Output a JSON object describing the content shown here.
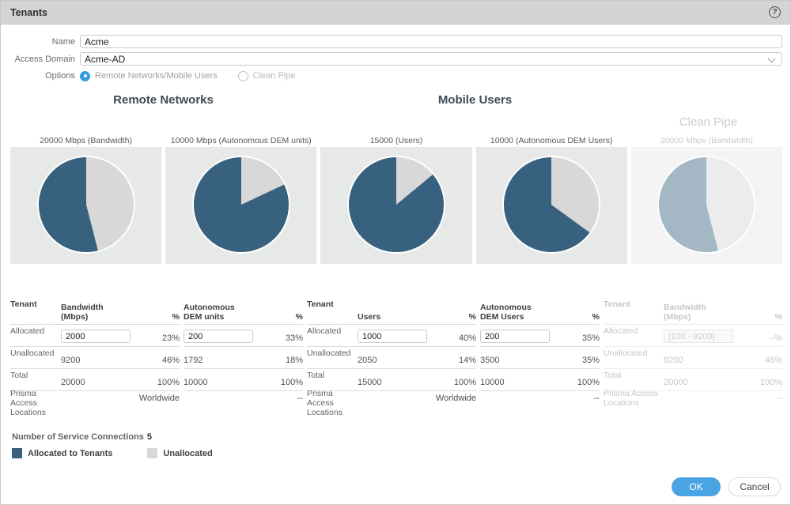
{
  "titlebar": {
    "title": "Tenants",
    "help_icon": "?"
  },
  "form": {
    "name_label": "Name",
    "name_value": "Acme",
    "access_domain_label": "Access Domain",
    "access_domain_value": "Acme-AD",
    "options_label": "Options",
    "option_rn_mu": "Remote Networks/Mobile Users",
    "option_clean_pipe": "Clean Pipe"
  },
  "sections": {
    "remote_networks": "Remote Networks",
    "mobile_users": "Mobile Users",
    "clean_pipe": "Clean Pipe"
  },
  "charts": [
    {
      "label": "20000 Mbps (Bandwidth)",
      "type": "pie",
      "allocated_pct": 54,
      "unallocated_pct": 46,
      "fill": "#38617f",
      "slice": "#d8d8d8",
      "disabled": false
    },
    {
      "label": "10000 Mbps (Autonomous DEM units)",
      "type": "pie",
      "allocated_pct": 82,
      "unallocated_pct": 18,
      "fill": "#38617f",
      "slice": "#d8d8d8",
      "disabled": false
    },
    {
      "label": "15000 (Users)",
      "type": "pie",
      "allocated_pct": 86,
      "unallocated_pct": 14,
      "fill": "#38617f",
      "slice": "#d8d8d8",
      "disabled": false
    },
    {
      "label": "10000 (Autonomous DEM Users)",
      "type": "pie",
      "allocated_pct": 65,
      "unallocated_pct": 35,
      "fill": "#38617f",
      "slice": "#d8d8d8",
      "disabled": false
    },
    {
      "label": "20000 Mbps (Bandwidth)",
      "type": "pie",
      "allocated_pct": 54,
      "unallocated_pct": 46,
      "fill": "#a4b7c5",
      "slice": "#ececec",
      "disabled": true
    }
  ],
  "tables": [
    {
      "corner": "Tenant",
      "value_header": "Bandwidth (Mbps)",
      "pct_header": "%",
      "rows": [
        {
          "label": "Allocated",
          "value": "2000",
          "pct": "23%"
        },
        {
          "label": "Unallocated",
          "value": "9200",
          "pct": "46%"
        },
        {
          "label": "Total",
          "value": "20000",
          "pct": "100%"
        },
        {
          "label": "Prisma Access Locations",
          "value": "",
          "pct": "Worldwide"
        }
      ]
    },
    {
      "value_header": "Autonomous DEM units",
      "pct_header": "%",
      "rows": [
        {
          "value": "200",
          "pct": "33%"
        },
        {
          "value": "1792",
          "pct": "18%"
        },
        {
          "value": "10000",
          "pct": "100%"
        },
        {
          "value": "",
          "pct": "--"
        }
      ]
    },
    {
      "corner": "Tenant",
      "value_header": "Users",
      "pct_header": "%",
      "rows": [
        {
          "label": "Allocated",
          "value": "1000",
          "pct": "40%"
        },
        {
          "label": "Unallocated",
          "value": "2050",
          "pct": "14%"
        },
        {
          "label": "Total",
          "value": "15000",
          "pct": "100%"
        },
        {
          "label": "Prisma Access Locations",
          "value": "",
          "pct": "Worldwide"
        }
      ]
    },
    {
      "value_header": "Autonomous DEM Users",
      "pct_header": "%",
      "rows": [
        {
          "value": "200",
          "pct": "35%"
        },
        {
          "value": "3500",
          "pct": "35%"
        },
        {
          "value": "10000",
          "pct": "100%"
        },
        {
          "value": "",
          "pct": "--"
        }
      ]
    },
    {
      "corner": "Tenant",
      "value_header": "Bandwidth (Mbps)",
      "pct_header": "%",
      "rows": [
        {
          "label": "Allocated",
          "placeholder": "[100 - 9200]",
          "pct": "--%"
        },
        {
          "label": "Unallocated",
          "value": "9200",
          "pct": "46%"
        },
        {
          "label": "Total",
          "value": "20000",
          "pct": "100%"
        },
        {
          "label": "Prisma Access Locations",
          "value": "",
          "pct": "--"
        }
      ]
    }
  ],
  "service_connections": {
    "label": "Number of Service Connections",
    "value": "5"
  },
  "legend": [
    {
      "label": "Allocated to Tenants",
      "color": "#38617f"
    },
    {
      "label": "Unallocated",
      "color": "#d8d8d8"
    }
  ],
  "footer": {
    "ok_label": "OK",
    "cancel_label": "Cancel"
  },
  "colors": {
    "accent_blue": "#4aa4e4",
    "pie_dark": "#38617f",
    "pie_gray": "#d8d8d8",
    "pie_disabled": "#a4b7c5",
    "titlebar_bg": "#d3d4d4"
  }
}
